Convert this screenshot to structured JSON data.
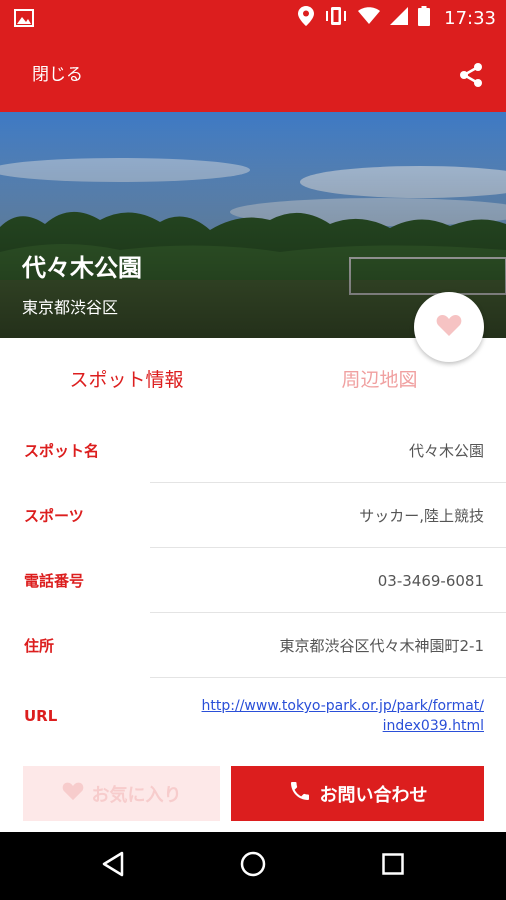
{
  "status_bar": {
    "time": "17:33"
  },
  "app_bar": {
    "close_label": "閉じる"
  },
  "hero": {
    "title": "代々木公園",
    "subtitle": "東京都渋谷区"
  },
  "tabs": [
    {
      "label": "スポット情報",
      "active": true
    },
    {
      "label": "周辺地図",
      "active": false
    }
  ],
  "details": [
    {
      "label": "スポット名",
      "value": "代々木公園"
    },
    {
      "label": "スポーツ",
      "value": "サッカー,陸上競技"
    },
    {
      "label": "電話番号",
      "value": "03-3469-6081"
    },
    {
      "label": "住所",
      "value": "東京都渋谷区代々木神園町2-1"
    }
  ],
  "url_row": {
    "label": "URL",
    "line1": "http://www.tokyo-park.or.jp/park/format/",
    "line2": "index039.html"
  },
  "buttons": {
    "favorite_label": "お気に入り",
    "contact_label": "お問い合わせ"
  },
  "colors": {
    "accent": "#dc1e1e",
    "link": "#2a4fd8"
  }
}
